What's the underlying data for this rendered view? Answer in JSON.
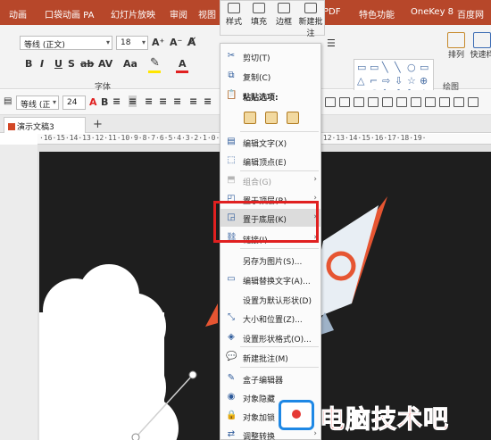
{
  "menubar": {
    "tabs": [
      "动画",
      "口袋动画 PA",
      "幻灯片放映",
      "审阅",
      "视图",
      "PDF",
      "特色功能",
      "OneKey 8",
      "百度网"
    ]
  },
  "ribbon": {
    "font_name": "等线 (正文)",
    "font_size": "18",
    "font_group_label": "字体",
    "drawing_group_label": "绘图",
    "arrange_label": "排列",
    "quick_style_label": "快速样",
    "format_buttons": [
      "B",
      "I",
      "U",
      "S",
      "ab",
      "AV",
      "Aa",
      "A"
    ],
    "grow_font": "A⁺",
    "shrink_font": "A⁻",
    "accent": "#b7472a"
  },
  "quickbar": {
    "font_name": "等线 (正",
    "font_size": "24"
  },
  "tabs": {
    "doc_name": "演示文稿3",
    "new_tab": "+"
  },
  "ruler": {
    "text": "·16·15·14·13·12·11·10·9·8·7·6·5·4·3·2·1·0·1·2·3·4·5·6·7·8·9·10·11·12·13·14·15·16·17·18·19·"
  },
  "context_menu": {
    "top_buttons": [
      "样式",
      "填充",
      "边框",
      "新建批注"
    ],
    "items": [
      {
        "icon": "scissors-icon",
        "glyph": "✂",
        "label": "剪切(T)"
      },
      {
        "icon": "copy-icon",
        "glyph": "⧉",
        "label": "复制(C)"
      },
      {
        "icon": "clipboard-icon",
        "glyph": "📋",
        "label": "粘贴选项:"
      },
      {
        "icon": "edit-text-icon",
        "glyph": "▤",
        "label": "编辑文字(X)"
      },
      {
        "icon": "edit-points-icon",
        "glyph": "⬚",
        "label": "编辑顶点(E)"
      },
      {
        "icon": "group-icon",
        "glyph": "⬒",
        "label": "组合(G)",
        "disabled": true,
        "submenu": true
      },
      {
        "icon": "bring-to-front-icon",
        "glyph": "◰",
        "label": "置于顶层(R)",
        "submenu": true
      },
      {
        "icon": "send-to-back-icon",
        "glyph": "◲",
        "label": "置于底层(K)",
        "submenu": true,
        "highlighted": true
      },
      {
        "icon": "link-icon",
        "glyph": "⛓",
        "label": "链接(I)",
        "submenu": true
      },
      {
        "icon": "none",
        "glyph": "",
        "label": "另存为图片(S)..."
      },
      {
        "icon": "alt-text-icon",
        "glyph": "▭",
        "label": "编辑替换文字(A)..."
      },
      {
        "icon": "none",
        "glyph": "",
        "label": "设置为默认形状(D)"
      },
      {
        "icon": "size-position-icon",
        "glyph": "⤡",
        "label": "大小和位置(Z)..."
      },
      {
        "icon": "format-shape-icon",
        "glyph": "◈",
        "label": "设置形状格式(O)..."
      },
      {
        "icon": "new-comment-icon",
        "glyph": "💬",
        "label": "新建批注(M)"
      },
      {
        "icon": "box-editor-icon",
        "glyph": "✎",
        "label": "盒子编辑器"
      },
      {
        "icon": "hide-object-icon",
        "glyph": "◉",
        "label": "对象隐藏"
      },
      {
        "icon": "lock-object-icon",
        "glyph": "🔒",
        "label": "对象加锁"
      },
      {
        "icon": "convert-icon",
        "glyph": "⇄",
        "label": "调整转换",
        "submenu": true
      }
    ]
  },
  "watermark": {
    "text": "电脑技术吧"
  },
  "colors": {
    "highlight_box": "#e02020",
    "slide_bg": "#1e1e1e",
    "watermark_text": "#e53935"
  }
}
